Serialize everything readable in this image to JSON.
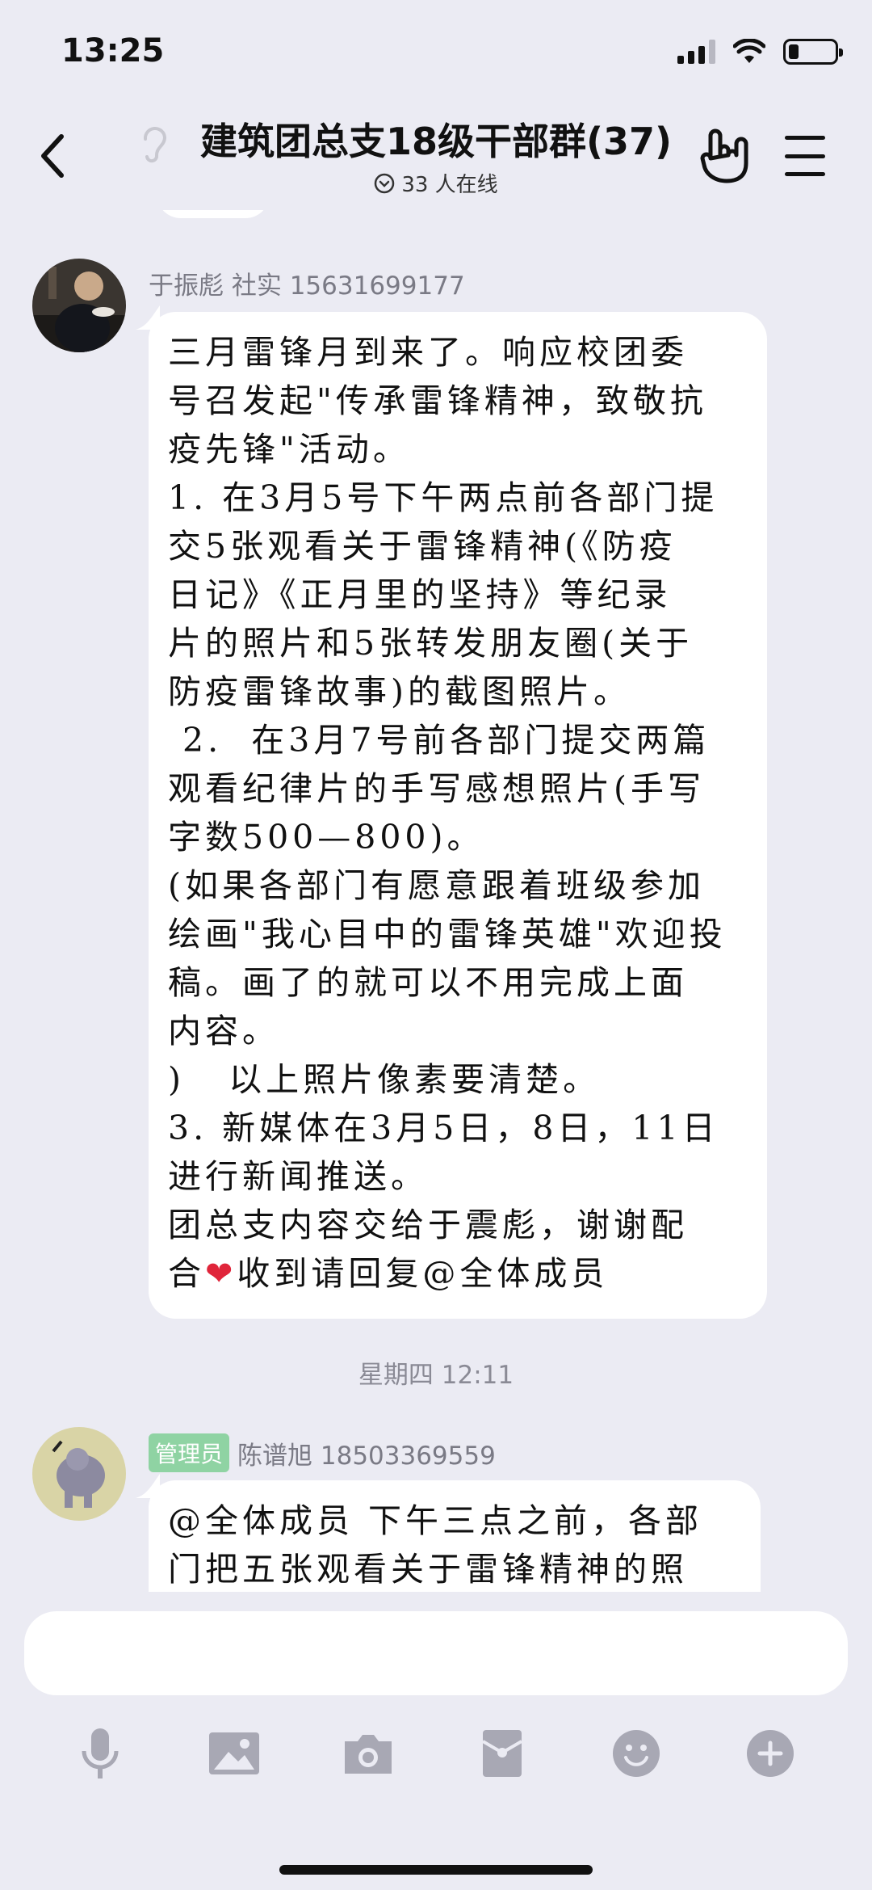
{
  "status_bar": {
    "time": "13:25"
  },
  "nav": {
    "title": "建筑团总支18级干部群(37)",
    "online": "33 人在线"
  },
  "messages": [
    {
      "sender": "于振彪 社实 15631699177",
      "text": "三月雷锋月到来了。响应校团委\n号召发起\"传承雷锋精神，致敬抗\n疫先锋\"活动。\n1. 在3月5号下午两点前各部门提\n交5张观看关于雷锋精神(《防疫\n日记》《正月里的坚持》等纪录\n片的照片和5张转发朋友圈(关于\n防疫雷锋故事)的截图照片。\n 2.  在3月7号前各部门提交两篇\n观看纪律片的手写感想照片(手写\n字数500—800)。\n(如果各部门有愿意跟着班级参加\n绘画\"我心目中的雷锋英雄\"欢迎投\n稿。画了的就可以不用完成上面\n内容。\n)   以上照片像素要清楚。\n3. 新媒体在3月5日，8日，11日\n进行新闻推送。\n团总支内容交给于震彪，谢谢配\n合",
      "text_tail": "收到请回复@全体成员"
    },
    {
      "badge": "管理员",
      "sender": "陈谱旭 18503369559",
      "text": "@全体成员 下午三点之前，各部\n门把五张观看关于雷锋精神的照"
    }
  ],
  "timestamp": "星期四 12:11",
  "input": {
    "placeholder": ""
  },
  "toolbar": {
    "icons": [
      "microphone-icon",
      "image-icon",
      "camera-icon",
      "red-packet-icon",
      "emoji-icon",
      "plus-icon"
    ]
  }
}
